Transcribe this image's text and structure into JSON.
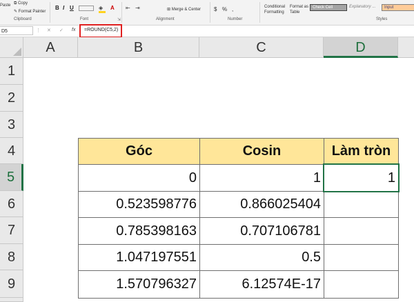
{
  "ribbon": {
    "clipboard": {
      "paste": "Paste",
      "copy": "Copy",
      "format_painter": "Format Painter",
      "label": "Clipboard"
    },
    "font": {
      "bold": "B",
      "italic": "I",
      "underline": "U",
      "label": "Font"
    },
    "alignment": {
      "merge_center": "Merge & Center",
      "label": "Alignment"
    },
    "number": {
      "currency": "$",
      "percent": "%",
      "comma": ",",
      "label": "Number"
    },
    "styles": {
      "conditional_formatting": [
        "Conditional",
        "Formatting"
      ],
      "format_as_table": [
        "Format as",
        "Table"
      ],
      "check_cell": "Check Cell",
      "explanatory": "Explanatory ...",
      "input": "Input",
      "label": "Styles"
    }
  },
  "formula_bar": {
    "name_box": "D5",
    "fx": "fx",
    "formula": "=ROUND(C5,2)"
  },
  "grid": {
    "columns": [
      "A",
      "B",
      "C",
      "D"
    ],
    "rows": [
      "1",
      "2",
      "3",
      "4",
      "5",
      "6",
      "7",
      "8",
      "9"
    ],
    "active_cell": "D5",
    "table": {
      "headers": [
        "Góc",
        "Cosin",
        "Làm tròn"
      ],
      "rows": [
        [
          "0",
          "1",
          "1"
        ],
        [
          "0.523598776",
          "0.866025404",
          ""
        ],
        [
          "0.785398163",
          "0.707106781",
          ""
        ],
        [
          "1.047197551",
          "0.5",
          ""
        ],
        [
          "1.570796327",
          "6.12574E-17",
          ""
        ]
      ]
    }
  },
  "colors": {
    "header_fill": "#ffe699",
    "selection": "#217346",
    "annotation": "#e02020",
    "check_cell_fill": "#a5a5a5",
    "input_fill": "#ffcc99"
  }
}
